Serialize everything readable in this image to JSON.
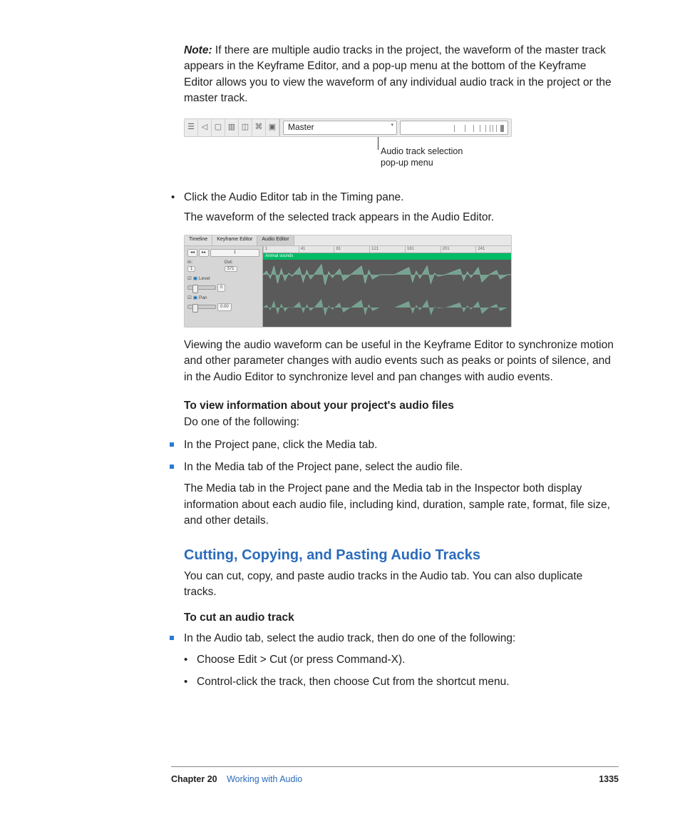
{
  "note": {
    "label": "Note:",
    "text": "If there are multiple audio tracks in the project, the waveform of the master track appears in the Keyframe Editor, and a pop-up menu at the bottom of the Keyframe Editor allows you to view the waveform of any individual audio track in the project or the master track."
  },
  "fig1": {
    "dropdown": "Master",
    "callout_line1": "Audio track selection",
    "callout_line2": "pop-up menu"
  },
  "step1": {
    "bullet": "Click the Audio Editor tab in the Timing pane.",
    "result": "The waveform of the selected track appears in the Audio Editor."
  },
  "fig2": {
    "tabs": {
      "a": "Timeline",
      "b": "Keyframe Editor",
      "c": "Audio Editor"
    },
    "frame_field": "1",
    "in_label": "In:",
    "in_val": "1",
    "out_label": "Out:",
    "out_val": "371",
    "level_label": "Level",
    "level_val": "0",
    "pan_label": "Pan",
    "pan_val": "0.00",
    "ruler": {
      "a": "1",
      "b": "41",
      "c": "81",
      "d": "121",
      "e": "161",
      "f": "201",
      "g": "241"
    },
    "clip": "Animal sounds"
  },
  "after_fig2": "Viewing the audio waveform can be useful in the Keyframe Editor to synchronize motion and other parameter changes with audio events such as peaks or points of silence, and in the Audio Editor to synchronize level and pan changes with audio events.",
  "view_info": {
    "heading": "To view information about your project's audio files",
    "lead": "Do one of the following:",
    "b1": "In the Project pane, click the Media tab.",
    "b2": "In the Media tab of the Project pane, select the audio file.",
    "detail": "The Media tab in the Project pane and the Media tab in the Inspector both display information about each audio file, including kind, duration, sample rate, format, file size, and other details."
  },
  "section": {
    "title": "Cutting, Copying, and Pasting Audio Tracks",
    "intro": "You can cut, copy, and paste audio tracks in the Audio tab. You can also duplicate tracks.",
    "sub_heading": "To cut an audio track",
    "b1": "In the Audio tab, select the audio track, then do one of the following:",
    "s1": "Choose Edit > Cut (or press Command-X).",
    "s2": "Control-click the track, then choose Cut from the shortcut menu."
  },
  "footer": {
    "chapter": "Chapter 20",
    "title": "Working with Audio",
    "page": "1335"
  }
}
